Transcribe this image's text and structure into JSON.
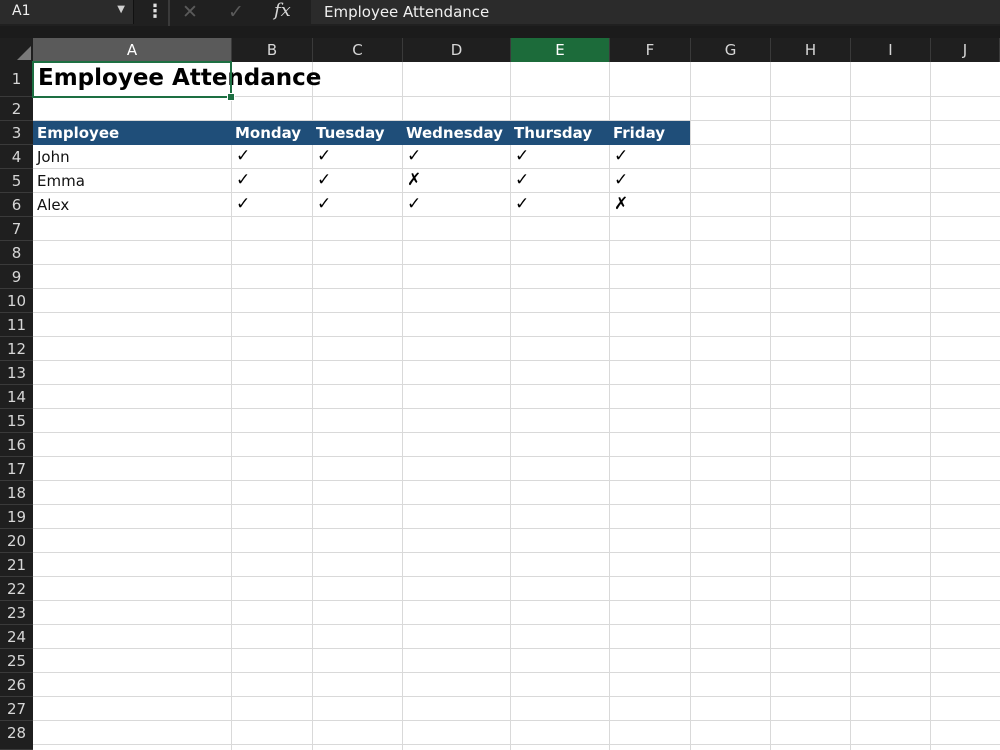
{
  "formula_bar": {
    "name_box": "A1",
    "name_box_arrow": "▼",
    "more_icon": "⋮",
    "cancel_icon": "✕",
    "enter_icon": "✓",
    "fx_label": "fx",
    "formula": "Employee Attendance"
  },
  "columns": [
    "A",
    "B",
    "C",
    "D",
    "E",
    "F",
    "G",
    "H",
    "I",
    "J"
  ],
  "rows": [
    "1",
    "2",
    "3",
    "4",
    "5",
    "6",
    "7",
    "8",
    "9",
    "10",
    "11",
    "12",
    "13",
    "14",
    "15",
    "16",
    "17",
    "18",
    "19",
    "20",
    "21",
    "22",
    "23",
    "24",
    "25",
    "26",
    "27",
    "28"
  ],
  "sheet": {
    "title": "Employee Attendance",
    "table_headers": [
      "Employee",
      "Monday",
      "Tuesday",
      "Wednesday",
      "Thursday",
      "Friday"
    ],
    "table_rows": [
      {
        "name": "John",
        "marks": [
          "✓",
          "✓",
          "✓",
          "✓",
          "✓"
        ]
      },
      {
        "name": "Emma",
        "marks": [
          "✓",
          "✓",
          "✗",
          "✓",
          "✓"
        ]
      },
      {
        "name": "Alex",
        "marks": [
          "✓",
          "✓",
          "✓",
          "✓",
          "✗"
        ]
      }
    ]
  },
  "colors": {
    "header_band": "#1f4e79",
    "selection": "#1d6f42",
    "active_column_header": "#1c6b3a"
  }
}
